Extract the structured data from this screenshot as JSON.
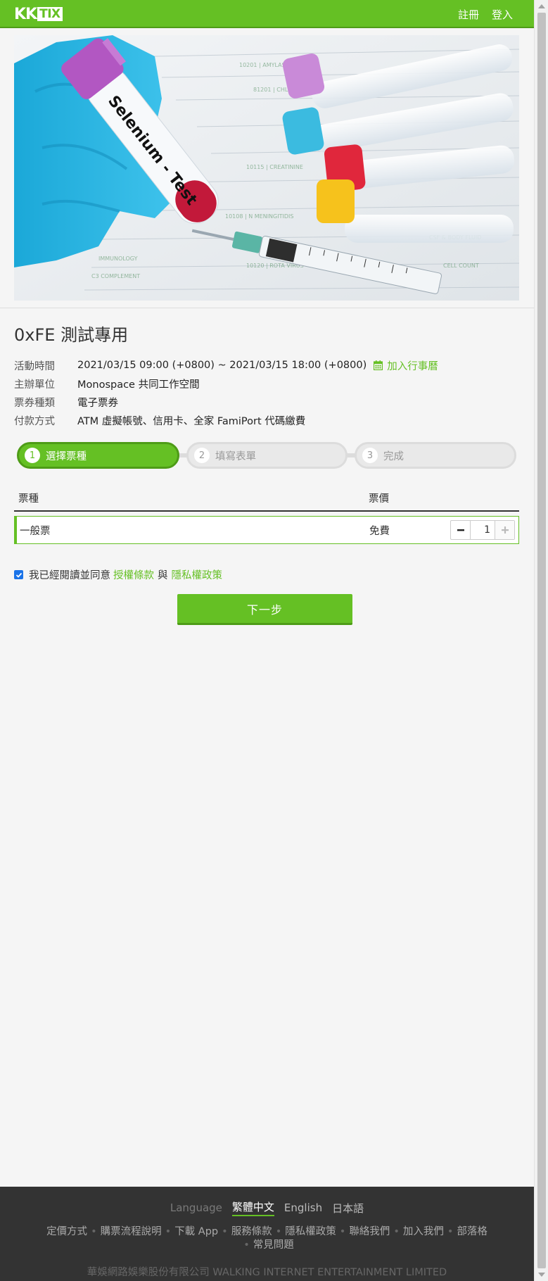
{
  "header": {
    "logo_left": "KK",
    "logo_box": "TIX",
    "register": "註冊",
    "login": "登入"
  },
  "banner": {
    "tube_label": "Selenium - Test"
  },
  "event": {
    "title": "0xFE 測試專用",
    "info": [
      {
        "label": "活動時間",
        "value": "2021/03/15 09:00 (+0800) ~ 2021/03/15 18:00 (+0800)"
      },
      {
        "label": "主辦單位",
        "value": "Monospace 共同工作空間"
      },
      {
        "label": "票券種類",
        "value": "電子票券"
      },
      {
        "label": "付款方式",
        "value": "ATM 虛擬帳號、信用卡、全家 FamiPort 代碼繳費"
      }
    ],
    "calendar_link": "加入行事曆"
  },
  "steps": [
    {
      "num": "1",
      "label": "選擇票種"
    },
    {
      "num": "2",
      "label": "填寫表單"
    },
    {
      "num": "3",
      "label": "完成"
    }
  ],
  "table": {
    "col_name": "票種",
    "col_price": "票價",
    "rows": [
      {
        "name": "一般票",
        "price": "免費",
        "qty": "1"
      }
    ]
  },
  "agree": {
    "prefix": "我已經閱讀並同意",
    "terms": "授權條款",
    "and": "與",
    "privacy": "隱私權政策"
  },
  "next_button": "下一步",
  "footer": {
    "language_label": "Language",
    "languages": [
      "繁體中文",
      "English",
      "日本語"
    ],
    "links": [
      "定價方式",
      "購票流程說明",
      "下載 App",
      "服務條款",
      "隱私權政策",
      "聯絡我們",
      "加入我們",
      "部落格",
      "常見問題"
    ],
    "copyright": "華娛網路娛樂股份有限公司 WALKING INTERNET ENTERTAINMENT LIMITED"
  },
  "colors": {
    "brand_green": "#65c024",
    "brand_green_dark": "#4e9c17",
    "footer_bg": "#333333"
  }
}
